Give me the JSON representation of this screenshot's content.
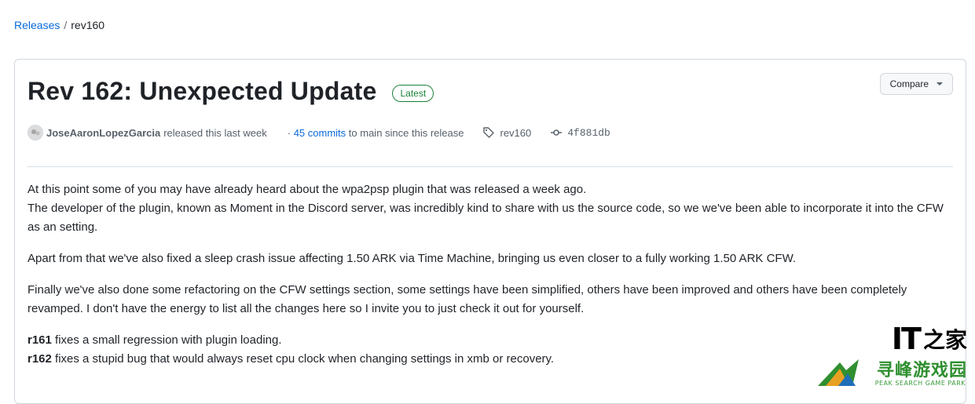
{
  "breadcrumb": {
    "releases": "Releases",
    "separator": "/",
    "current": "rev160"
  },
  "release": {
    "title": "Rev 162: Unexpected Update",
    "badge": "Latest",
    "compare_label": "Compare",
    "author": "JoseAaronLopezGarcia",
    "released_text": "released this last week",
    "commits_prefix": "·",
    "commits_link": "45 commits",
    "commits_suffix": "to main since this release",
    "tag": "rev160",
    "commit_sha": "4f881db"
  },
  "body": {
    "p1_line1": "At this point some of you may have already heard about the wpa2psp plugin that was released a week ago.",
    "p1_line2": "The developer of the plugin, known as Moment in the Discord server, was incredibly kind to share with us the source code, so we we've been able to incorporate it into the CFW as an setting.",
    "p2": "Apart from that we've also fixed a sleep crash issue affecting 1.50 ARK via Time Machine, bringing us even closer to a fully working 1.50 ARK CFW.",
    "p3": "Finally we've also done some refactoring on the CFW settings section, some settings have been simplified, others have been improved and others have been completely revamped. I don't have the energy to list all the changes here so I invite you to just check it out for yourself.",
    "r161_label": "r161",
    "r161_text": " fixes a small regression with plugin loading.",
    "r162_label": "r162",
    "r162_text": " fixes a stupid bug that would always reset cpu clock when changing settings in xmb or recovery."
  },
  "watermark": {
    "it": "IT",
    "zh": "之家",
    "name": "寻峰游戏园",
    "sub": "PEAK SEARCH GAME PARK"
  },
  "colors": {
    "link": "#0969da",
    "badge": "#1a7f37",
    "text": "#1f2328",
    "muted": "#57606a"
  },
  "icons": [
    "avatar",
    "tag-icon",
    "commit-icon",
    "caret-down-icon",
    "watermark-logo"
  ]
}
